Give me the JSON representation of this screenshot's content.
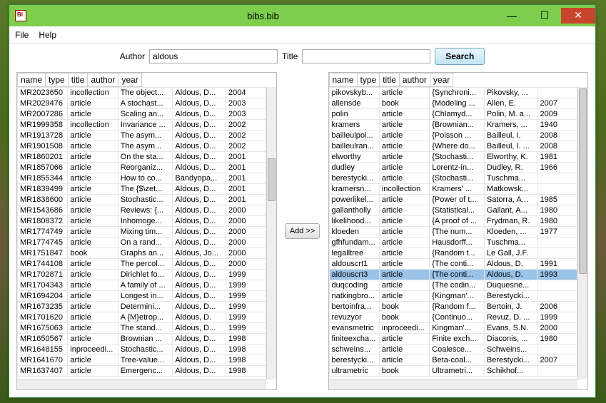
{
  "window": {
    "title": "bibs.bib"
  },
  "menu": {
    "file": "File",
    "help": "Help"
  },
  "search": {
    "author_label": "Author",
    "author_value": "aldous",
    "title_label": "Title",
    "title_value": "",
    "button": "Search"
  },
  "add_button": "Add >>",
  "columns": {
    "name": "name",
    "type": "type",
    "title": "title",
    "author": "author",
    "year": "year"
  },
  "left_rows": [
    {
      "name": "MR2023650",
      "type": "incollection",
      "title": "The object...",
      "author": "Aldous, D...",
      "year": "2004"
    },
    {
      "name": "MR2029476",
      "type": "article",
      "title": "A stochast...",
      "author": "Aldous, D...",
      "year": "2003"
    },
    {
      "name": "MR2007286",
      "type": "article",
      "title": "Scaling an...",
      "author": "Aldous, D...",
      "year": "2003"
    },
    {
      "name": "MR1999358",
      "type": "incollection",
      "title": "Invariance ...",
      "author": "Aldous, D...",
      "year": "2002"
    },
    {
      "name": "MR1913728",
      "type": "article",
      "title": "The asym...",
      "author": "Aldous, D...",
      "year": "2002"
    },
    {
      "name": "MR1901508",
      "type": "article",
      "title": "The asym...",
      "author": "Aldous, D...",
      "year": "2002"
    },
    {
      "name": "MR1860201",
      "type": "article",
      "title": "On the sta...",
      "author": "Aldous, D...",
      "year": "2001"
    },
    {
      "name": "MR1857066",
      "type": "article",
      "title": "Reorganiz...",
      "author": "Aldous, D...",
      "year": "2001"
    },
    {
      "name": "MR1855344",
      "type": "article",
      "title": "How to co...",
      "author": "Bandyopa...",
      "year": "2001"
    },
    {
      "name": "MR1839499",
      "type": "article",
      "title": "The {$\\zet...",
      "author": "Aldous, D...",
      "year": "2001"
    },
    {
      "name": "MR1838600",
      "type": "article",
      "title": "Stochastic...",
      "author": "Aldous, D...",
      "year": "2001"
    },
    {
      "name": "MR1543686",
      "type": "article",
      "title": "Reviews: {...",
      "author": "Aldous, D...",
      "year": "2000"
    },
    {
      "name": "MR1808372",
      "type": "article",
      "title": "Inhomoge...",
      "author": "Aldous, D...",
      "year": "2000"
    },
    {
      "name": "MR1774749",
      "type": "article",
      "title": "Mixing tim...",
      "author": "Aldous, D...",
      "year": "2000"
    },
    {
      "name": "MR1774745",
      "type": "article",
      "title": "On a rand...",
      "author": "Aldous, D...",
      "year": "2000"
    },
    {
      "name": "MR1751847",
      "type": "book",
      "title": "Graphs an...",
      "author": "Aldous, Jo...",
      "year": "2000"
    },
    {
      "name": "MR1744108",
      "type": "article",
      "title": "The percol...",
      "author": "Aldous, D...",
      "year": "2000"
    },
    {
      "name": "MR1702871",
      "type": "article",
      "title": "Dirichlet fo...",
      "author": "Aldous, D...",
      "year": "1999"
    },
    {
      "name": "MR1704343",
      "type": "article",
      "title": "A family of ...",
      "author": "Aldous, D...",
      "year": "1999"
    },
    {
      "name": "MR1694204",
      "type": "article",
      "title": "Longest in...",
      "author": "Aldous, D...",
      "year": "1999"
    },
    {
      "name": "MR1673235",
      "type": "article",
      "title": "Determini...",
      "author": "Aldous, D...",
      "year": "1999"
    },
    {
      "name": "MR1701620",
      "type": "article",
      "title": "A {M}etrop...",
      "author": "Aldous, D.",
      "year": "1999"
    },
    {
      "name": "MR1675063",
      "type": "article",
      "title": "The stand...",
      "author": "Aldous, D...",
      "year": "1999"
    },
    {
      "name": "MR1650567",
      "type": "article",
      "title": "Brownian ...",
      "author": "Aldous, D...",
      "year": "1998"
    },
    {
      "name": "MR1648155",
      "type": "inproceedi...",
      "title": "Stochastic...",
      "author": "Aldous, D...",
      "year": "1998"
    },
    {
      "name": "MR1641670",
      "type": "article",
      "title": "Tree-value...",
      "author": "Aldous, D...",
      "year": "1998"
    },
    {
      "name": "MR1637407",
      "type": "article",
      "title": "Emergenc...",
      "author": "Aldous, D...",
      "year": "1998"
    }
  ],
  "right_rows": [
    {
      "name": "pikovskyb...",
      "type": "article",
      "title": "{Synchroni...",
      "author": "Pikovsky, ...",
      "year": ""
    },
    {
      "name": "allensde",
      "type": "book",
      "title": "{Modeling ...",
      "author": "Allen, E.",
      "year": "2007"
    },
    {
      "name": "polin",
      "type": "article",
      "title": "{Chlamyd...",
      "author": "Polin, M. a...",
      "year": "2009"
    },
    {
      "name": "kramers",
      "type": "article",
      "title": "{Brownian...",
      "author": "Kramers, ...",
      "year": "1940"
    },
    {
      "name": "bailleulpoi...",
      "type": "article",
      "title": "{Poisson ...",
      "author": "Bailleul, I.",
      "year": "2008"
    },
    {
      "name": "bailleulran...",
      "type": "article",
      "title": "{Where do...",
      "author": "Bailleul, I. ...",
      "year": "2008"
    },
    {
      "name": "elworthy",
      "type": "article",
      "title": "{Stochasti...",
      "author": "Elworthy, K.",
      "year": "1981"
    },
    {
      "name": "dudley",
      "type": "article",
      "title": "Lorentz-in...",
      "author": "Dudley, R.",
      "year": "1966"
    },
    {
      "name": "berestycki...",
      "type": "article",
      "title": "{Stochasti...",
      "author": "Tuschma...",
      "year": ""
    },
    {
      "name": "kramersn...",
      "type": "incollection",
      "title": "Kramers' ...",
      "author": "Matkowsk...",
      "year": ""
    },
    {
      "name": "powerlikel...",
      "type": "article",
      "title": "{Power of t...",
      "author": "Satorra, A...",
      "year": "1985"
    },
    {
      "name": "gallantholly",
      "type": "article",
      "title": "{Statistical...",
      "author": "Gallant, A...",
      "year": "1980"
    },
    {
      "name": "likelihood...",
      "type": "article",
      "title": "{A proof of ...",
      "author": "Frydman, R.",
      "year": "1980"
    },
    {
      "name": "kloeden",
      "type": "article",
      "title": "{The num...",
      "author": "Kloeden, ...",
      "year": "1977"
    },
    {
      "name": "gfhfundam...",
      "type": "article",
      "title": "Hausdorff...",
      "author": "Tuschma...",
      "year": ""
    },
    {
      "name": "legalltree",
      "type": "article",
      "title": "{Random t...",
      "author": "Le Gall, J.F.",
      "year": ""
    },
    {
      "name": "aldouscrt1",
      "type": "article",
      "title": "{The conti...",
      "author": "Aldous, D.",
      "year": "1991"
    },
    {
      "name": "aldouscrt3",
      "type": "article",
      "title": "{The conti...",
      "author": "Aldous, D.",
      "year": "1993",
      "selected": true
    },
    {
      "name": "duqcoding",
      "type": "article",
      "title": "{The codin...",
      "author": "Duquesne...",
      "year": ""
    },
    {
      "name": "natkingbro...",
      "type": "article",
      "title": "{Kingman'...",
      "author": "Berestycki...",
      "year": ""
    },
    {
      "name": "bertoinfra...",
      "type": "book",
      "title": "{Random f...",
      "author": "Bertoin, J.",
      "year": "2006"
    },
    {
      "name": "revuzyor",
      "type": "book",
      "title": "{Continuo...",
      "author": "Revuz, D. ...",
      "year": "1999"
    },
    {
      "name": "evansmetric",
      "type": "inproceedi...",
      "title": "Kingman'...",
      "author": "Evans, S.N.",
      "year": "2000"
    },
    {
      "name": "finiteexcha...",
      "type": "article",
      "title": "Finite exch...",
      "author": "Diaconis, ...",
      "year": "1980"
    },
    {
      "name": "schweins...",
      "type": "article",
      "title": "Coalesce...",
      "author": "Schweins...",
      "year": ""
    },
    {
      "name": "berestycki...",
      "type": "article",
      "title": "Beta-coal...",
      "author": "Berestycki...",
      "year": "2007"
    },
    {
      "name": "ultrametric",
      "type": "book",
      "title": "Ultrametri...",
      "author": "Schikhof...",
      "year": ""
    }
  ]
}
